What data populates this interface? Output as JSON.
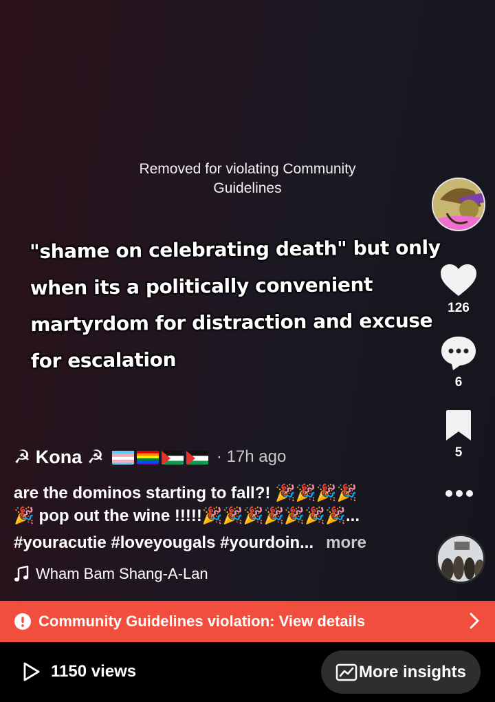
{
  "video": {
    "removed_notice": "Removed for violating Community Guidelines",
    "overlay_text": "\"shame on celebrating death\" but only when its a politically convenient martyrdom for distraction and excuse for escalation"
  },
  "rail": {
    "like_count": "126",
    "comment_count": "6",
    "save_count": "5",
    "icons": [
      "heart-icon",
      "comment-icon",
      "bookmark-icon",
      "more-icon"
    ]
  },
  "post": {
    "author_prefix": "☭ Kona ☭",
    "flags": [
      "transgender-flag",
      "rainbow-flag",
      "palestine-flag",
      "palestine-flag"
    ],
    "time_ago": "· 17h ago",
    "caption_line1": "are the dominos starting to fall?! 🎉🎉🎉🎉",
    "caption_line2": "🎉 pop out the wine !!!!!🎉🎉🎉🎉🎉🎉🎉...",
    "hashtags": "#youracutie #loveyougals #yourdoin...",
    "more_label": "more",
    "sound": "Wham Bam Shang-A-Lan"
  },
  "violation": {
    "label": "Community Guidelines violation: View details",
    "color": "#f14e3d"
  },
  "footer": {
    "views": "1150 views",
    "insights_label": "More insights"
  }
}
